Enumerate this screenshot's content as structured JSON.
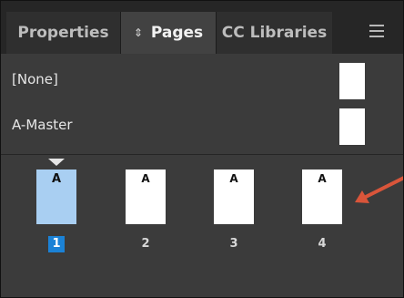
{
  "tabs": {
    "properties": "Properties",
    "pages": "Pages",
    "cc_libraries": "CC Libraries"
  },
  "masters": [
    {
      "label": "[None]"
    },
    {
      "label": "A-Master"
    }
  ],
  "pages": [
    {
      "prefix": "A",
      "number": "1",
      "selected": true
    },
    {
      "prefix": "A",
      "number": "2",
      "selected": false
    },
    {
      "prefix": "A",
      "number": "3",
      "selected": false
    },
    {
      "prefix": "A",
      "number": "4",
      "selected": false
    }
  ],
  "colors": {
    "panel_bg": "#3b3b3b",
    "tab_bar_bg": "#262626",
    "active_tab_bg": "#424242",
    "selected_page_fill": "#a9cff2",
    "selected_number_bg": "#1b82d6",
    "annotation_arrow": "#d9553a"
  },
  "icons": {
    "tab_updown": "updown-icon",
    "panel_menu": "hamburger-menu-icon",
    "current_spread": "triangle-down-icon",
    "annotation": "arrow-icon"
  }
}
